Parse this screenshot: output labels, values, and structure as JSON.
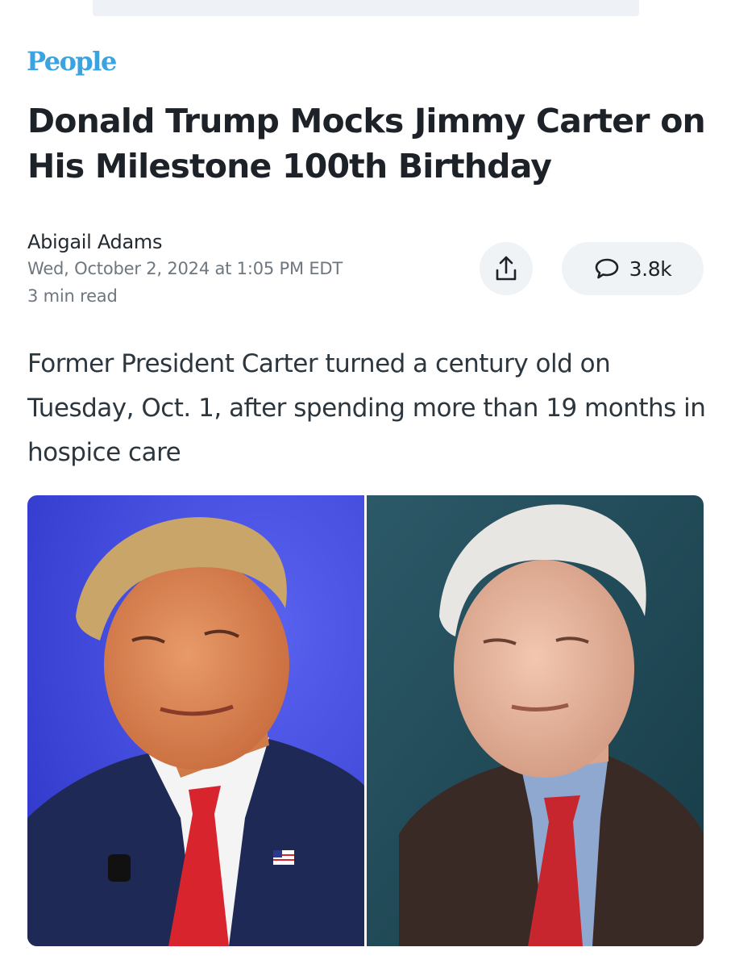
{
  "brand": {
    "logo_text": "People",
    "color": "#3aa3e0"
  },
  "article": {
    "headline": "Donald Trump Mocks Jimmy Carter on His Milestone 100th Birthday",
    "author": "Abigail Adams",
    "published": "Wed, October 2, 2024 at 1:05 PM EDT",
    "read_time": "3 min read",
    "summary": "Former President Carter turned a century old on Tuesday, Oct. 1, after spending more than 19 months in hospice care"
  },
  "actions": {
    "share_icon": "share-upload-icon",
    "comment_icon": "speech-bubble-icon",
    "comments_count": "3.8k"
  },
  "hero_image": {
    "panels": [
      {
        "subject": "Donald Trump",
        "background": "#3a47e8"
      },
      {
        "subject": "Jimmy Carter",
        "background": "#1f4a5a"
      }
    ]
  },
  "colors": {
    "headline": "#1d2228",
    "meta_text": "#6e7780",
    "button_bg": "#f0f3f5"
  }
}
